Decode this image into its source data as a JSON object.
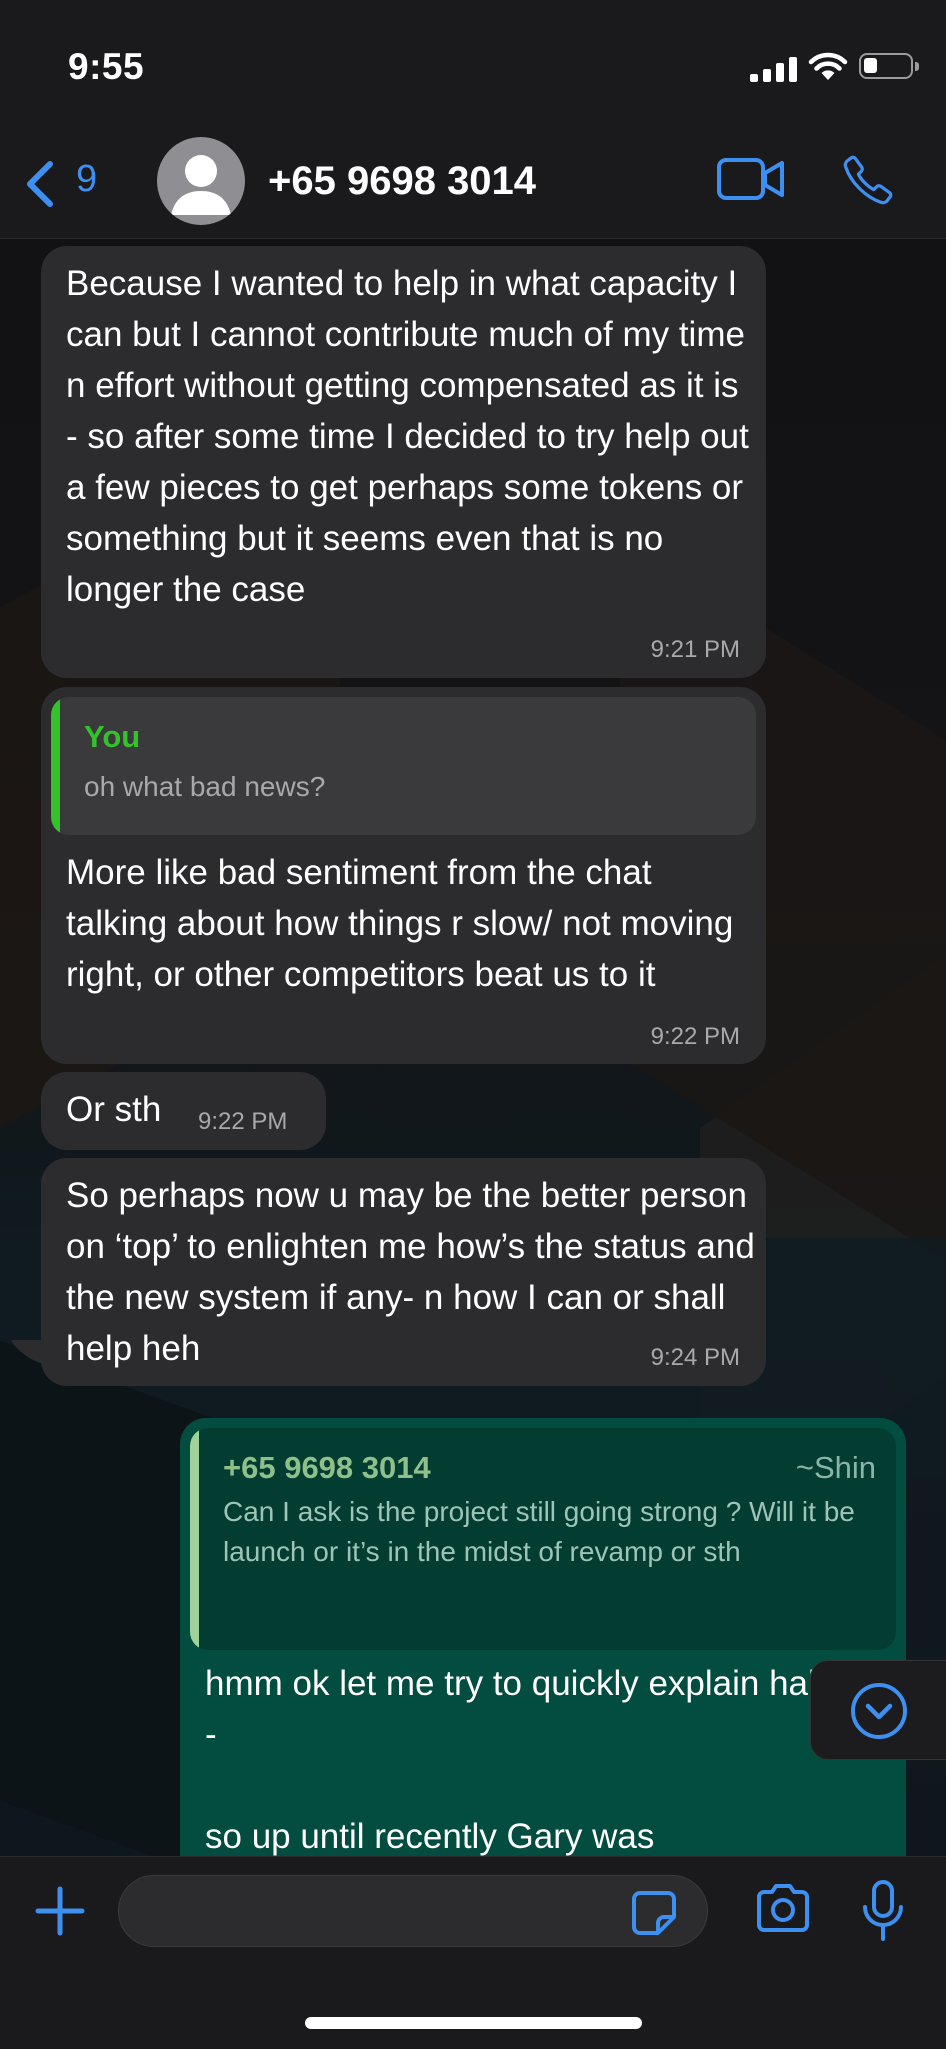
{
  "status_bar": {
    "time": "9:55",
    "battery_level": 0.2
  },
  "header": {
    "back_count": "9",
    "contact_name": "+65 9698 3014",
    "accent_color": "#3d8ff0"
  },
  "messages": [
    {
      "direction": "incoming",
      "text": "Because I wanted to help in what capacity I can but I cannot contribute much of my time n effort without getting compensated as it is - so after some time I decided to try help out a few pieces to get perhaps some tokens or something but it seems even that is no longer the case",
      "time": "9:21 PM"
    },
    {
      "direction": "incoming",
      "quote": {
        "author": "You",
        "text": "oh what bad news?"
      },
      "text": "More like bad sentiment from the chat talking about how things r slow/ not moving right, or other competitors beat us to it",
      "time": "9:22 PM"
    },
    {
      "direction": "incoming",
      "text": "Or sth",
      "time": "9:22 PM"
    },
    {
      "direction": "incoming",
      "text": "So perhaps now u may be the better person on ‘top’ to enlighten me how’s the status and the new system if any- n how I can or shall help heh",
      "time": "9:24 PM"
    },
    {
      "direction": "outgoing",
      "quote": {
        "author": "+65 9698 3014",
        "alias": "~Shin",
        "text": "Can I ask is the project still going strong ? Will it be launch or it’s in the midst of revamp or sth"
      },
      "text": "hmm ok let me try to quickly explain haha -\n\nso up until recently Gary was"
    }
  ],
  "colors": {
    "incoming_bubble": "#2c2c2f",
    "outgoing_bubble": "#024d3f",
    "quote_you": "#35c12a",
    "quote_contact": "#9fd29a"
  }
}
